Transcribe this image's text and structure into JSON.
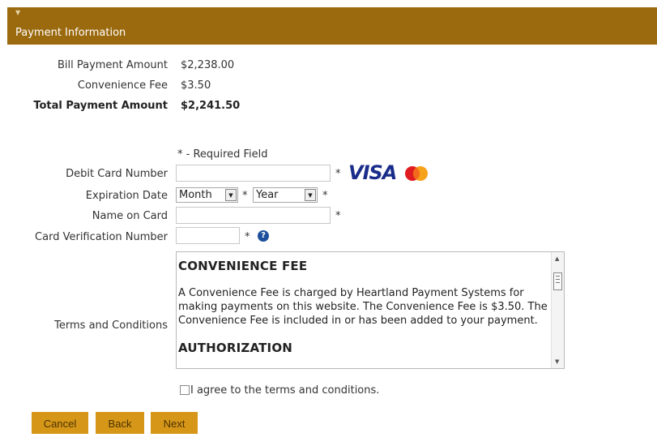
{
  "header": {
    "title": "Payment Information",
    "collapse_icon": "triangle-down-icon"
  },
  "summary": {
    "bill_label": "Bill Payment Amount",
    "bill_value": "$2,238.00",
    "fee_label": "Convenience Fee",
    "fee_value": "$3.50",
    "total_label": "Total Payment Amount",
    "total_value": "$2,241.50"
  },
  "form": {
    "required_note": "* - Required Field",
    "required_mark": "*",
    "card_number_label": "Debit Card Number",
    "expiration_label": "Expiration Date",
    "month_selected": "Month",
    "year_selected": "Year",
    "name_label": "Name on Card",
    "cvv_label": "Card Verification Number",
    "help_glyph": "?",
    "card_brands": {
      "visa": "VISA",
      "mastercard": "MasterCard"
    },
    "colors": {
      "visa": "#1a2c8a",
      "mc_red": "#e11b22",
      "mc_orange": "#f7a21b",
      "help": "#1d4f9c"
    }
  },
  "terms": {
    "label": "Terms and Conditions",
    "heading1": "CONVENIENCE FEE",
    "paragraph1": "A Convenience Fee is charged by Heartland Payment Systems for making payments on this website. The Convenience Fee is $3.50. The Convenience Fee is included in or has been added to your payment.",
    "heading2": "AUTHORIZATION",
    "agree_label": "I agree to the terms and conditions."
  },
  "buttons": {
    "cancel": "Cancel",
    "back": "Back",
    "next": "Next"
  },
  "theme": {
    "header_bg": "#9b6a0f",
    "button_bg": "#d69618",
    "button_text": "#4b3300"
  }
}
